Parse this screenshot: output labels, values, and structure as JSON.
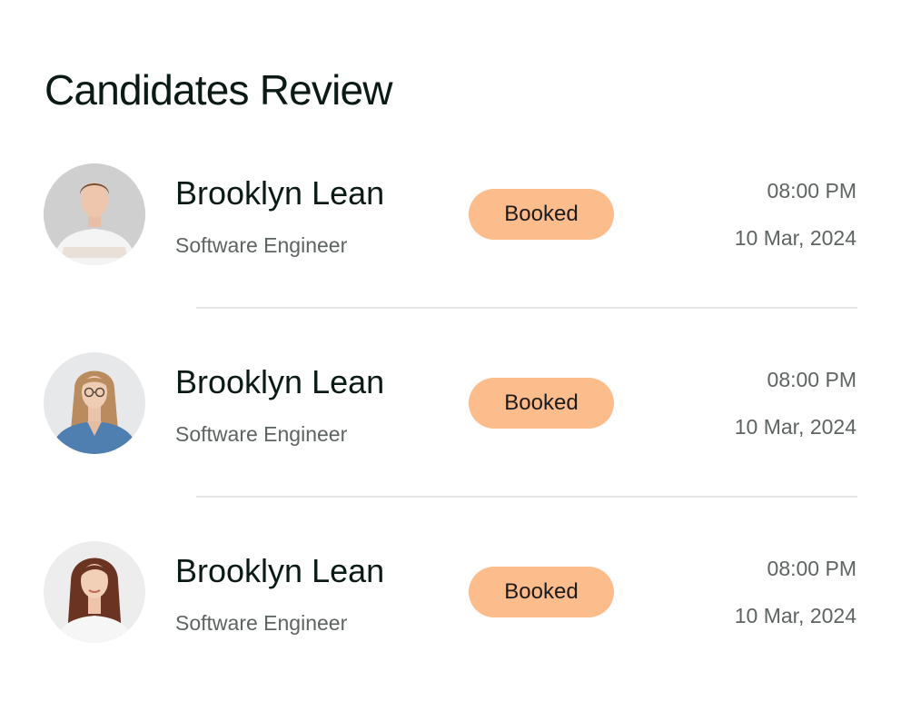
{
  "title": "Candidates Review",
  "colors": {
    "badge_bg": "#fcbc8b",
    "divider": "#e4e6e5",
    "title_text": "#0b1a14",
    "muted_text": "#5d6461"
  },
  "candidates": [
    {
      "name": "Brooklyn Lean",
      "role": "Software Engineer",
      "status": "Booked",
      "time": "08:00 PM",
      "date": "10 Mar, 2024",
      "avatar_icon": "avatar-man-white-tshirt"
    },
    {
      "name": "Brooklyn Lean",
      "role": "Software Engineer",
      "status": "Booked",
      "time": "08:00 PM",
      "date": "10 Mar, 2024",
      "avatar_icon": "avatar-woman-denim-shirt-glasses"
    },
    {
      "name": "Brooklyn Lean",
      "role": "Software Engineer",
      "status": "Booked",
      "time": "08:00 PM",
      "date": "10 Mar, 2024",
      "avatar_icon": "avatar-woman-long-brown-hair"
    }
  ]
}
